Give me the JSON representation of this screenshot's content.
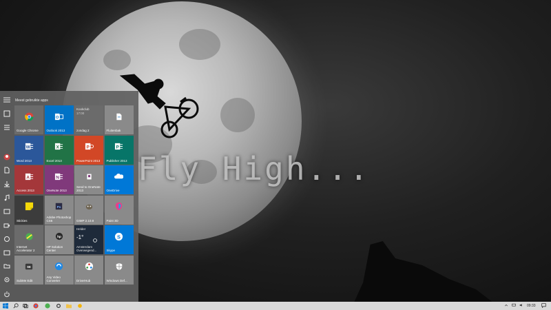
{
  "wallpaper": {
    "text": "Fly High..."
  },
  "start_menu": {
    "section_title": "Meest gebruikte apps",
    "tiles": [
      {
        "label": "Google Chrome",
        "icon": "chrome-icon",
        "color": "#6b6b6b"
      },
      {
        "label": "Outlook 2013",
        "icon": "outlook-icon",
        "color": "#0072c6"
      },
      {
        "label": "Kookclub",
        "sub1": "17:00",
        "sub2": "zondag 2",
        "icon": "calendar-icon",
        "color": "#6b6b6b"
      },
      {
        "label": "Fluitenbak",
        "icon": "file-icon",
        "color": "#8a8a8a"
      },
      {
        "label": "Word 2013",
        "icon": "word-icon",
        "color": "#2b579a"
      },
      {
        "label": "Excel 2013",
        "icon": "excel-icon",
        "color": "#217346"
      },
      {
        "label": "PowerPoint 2013",
        "icon": "powerpoint-icon",
        "color": "#d24726"
      },
      {
        "label": "Publisher 2013",
        "icon": "publisher-icon",
        "color": "#077568"
      },
      {
        "label": "Access 2013",
        "icon": "access-icon",
        "color": "#a4373a"
      },
      {
        "label": "OneNote 2013",
        "icon": "onenote-icon",
        "color": "#80397b"
      },
      {
        "label": "Send to OneNote 2013",
        "icon": "send-icon",
        "color": "#8a8a8a"
      },
      {
        "label": "OneDrive",
        "icon": "onedrive-icon",
        "color": "#0078d7"
      },
      {
        "label": "Stickies",
        "icon": "stickies-icon",
        "color": "#3c3c3c"
      },
      {
        "label": "Adobe Photoshop CS6",
        "icon": "photoshop-icon",
        "color": "#8a8a8a"
      },
      {
        "label": "GIMP 2.10.8",
        "icon": "gimp-icon",
        "color": "#8a8a8a"
      },
      {
        "label": "Paint 3D",
        "icon": "paint3d-icon",
        "color": "#8a8a8a"
      },
      {
        "label": "Internet Accelerator 2",
        "icon": "accelerator-icon",
        "color": "#6b6b6b"
      },
      {
        "label": "HP Solution Center",
        "icon": "hp-icon",
        "color": "#8a8a8a"
      },
      {
        "label": "Amsterdam",
        "sub1": "Helder",
        "sub2": "-1°",
        "sub3": "Overwegend...",
        "icon": "weather-icon",
        "color": "#1e2a3a"
      },
      {
        "label": "Skype",
        "icon": "skype-icon",
        "color": "#0078d7"
      },
      {
        "label": "SubMe Edit",
        "icon": "subtitle-icon",
        "color": "#8a8a8a"
      },
      {
        "label": "Any Video Converter",
        "icon": "converter-icon",
        "color": "#8a8a8a"
      },
      {
        "label": "DriverHub",
        "icon": "driverhub-icon",
        "color": "#8a8a8a"
      },
      {
        "label": "Windows Def...",
        "icon": "shield-icon",
        "color": "#8a8a8a"
      }
    ]
  },
  "taskbar": {
    "clock": "09:33",
    "search_tooltip": "Zoeken"
  }
}
